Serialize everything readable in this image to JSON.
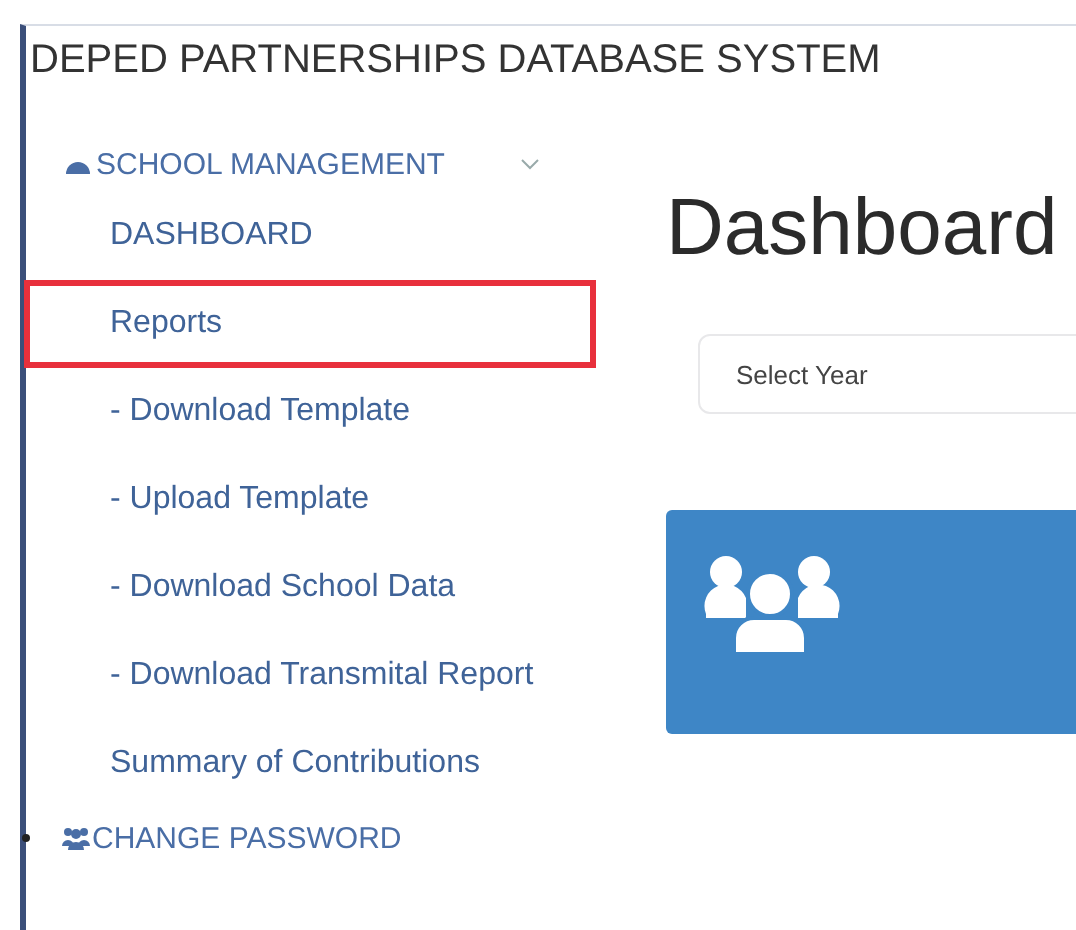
{
  "app_title": "DEPED PARTNERSHIPS DATABASE SYSTEM",
  "sidebar": {
    "section": {
      "label": "SCHOOL MANAGEMENT",
      "expanded": true
    },
    "items": [
      {
        "label": "DASHBOARD",
        "highlighted": false
      },
      {
        "label": "Reports",
        "highlighted": true
      },
      {
        "label": "- Download Template",
        "highlighted": false
      },
      {
        "label": "- Upload Template",
        "highlighted": false
      },
      {
        "label": "- Download School Data",
        "highlighted": false
      },
      {
        "label": "- Download Transmital Report",
        "highlighted": false
      },
      {
        "label": "Summary of Contributions",
        "highlighted": false
      }
    ],
    "bottom_item": {
      "label": "CHANGE PASSWORD"
    }
  },
  "main": {
    "heading": "Dashboard",
    "year_select": {
      "placeholder": "Select Year"
    }
  }
}
